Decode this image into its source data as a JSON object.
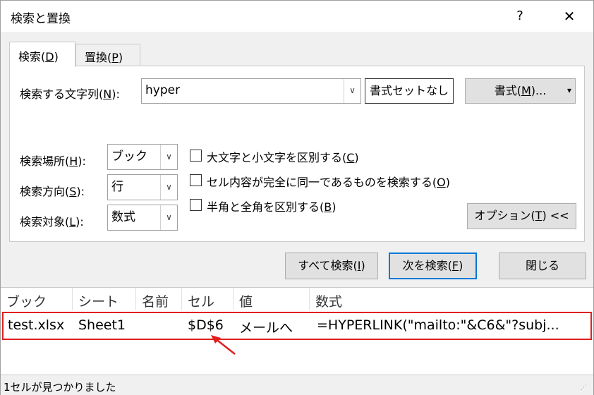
{
  "window": {
    "title": "検索と置換",
    "help_label": "?",
    "close_label": "✕"
  },
  "tabs": [
    {
      "label_pre": "検索(",
      "accel": "D",
      "label_post": ")"
    },
    {
      "label_pre": "置換(",
      "accel": "P",
      "label_post": ")"
    }
  ],
  "search": {
    "label_pre": "検索する文字列(",
    "accel": "N",
    "label_post": "):",
    "value": "hyper",
    "no_format_label": "書式セットなし",
    "format_button_pre": "書式(",
    "format_button_accel": "M",
    "format_button_post": ")...",
    "format_dropdown_arrow": "▾"
  },
  "options": {
    "within": {
      "label_pre": "検索場所(",
      "accel": "H",
      "label_post": "):",
      "value": "ブック"
    },
    "search_dir": {
      "label_pre": "検索方向(",
      "accel": "S",
      "label_post": "):",
      "value": "行"
    },
    "look_in": {
      "label_pre": "検索対象(",
      "accel": "L",
      "label_post": "):",
      "value": "数式"
    },
    "match_case": {
      "label_pre": "大文字と小文字を区別する(",
      "accel": "C",
      "label_post": ")",
      "checked": false
    },
    "entire_cell": {
      "label_pre": "セル内容が完全に同一であるものを検索する(",
      "accel": "O",
      "label_post": ")",
      "checked": false
    },
    "byte_width": {
      "label_pre": "半角と全角を区別する(",
      "accel": "B",
      "label_post": ")",
      "checked": false
    },
    "options_button_pre": "オプション(",
    "options_button_accel": "T",
    "options_button_post": ") <<"
  },
  "actions": {
    "find_all_pre": "すべて検索(",
    "find_all_accel": "I",
    "find_all_post": ")",
    "find_next_pre": "次を検索(",
    "find_next_accel": "F",
    "find_next_post": ")",
    "close_label": "閉じる"
  },
  "results": {
    "columns": [
      "ブック",
      "シート",
      "名前",
      "セル",
      "値",
      "数式"
    ],
    "rows": [
      {
        "book": "test.xlsx",
        "sheet": "Sheet1",
        "name": "",
        "cell": "$D$6",
        "value": "メールへ",
        "formula": "=HYPERLINK(\"mailto:\"&C6&\"?subj..."
      }
    ]
  },
  "status": {
    "text": "1セルが見つかりました"
  },
  "colors": {
    "highlight_border": "#e02020",
    "focus_border": "#0078d7"
  }
}
